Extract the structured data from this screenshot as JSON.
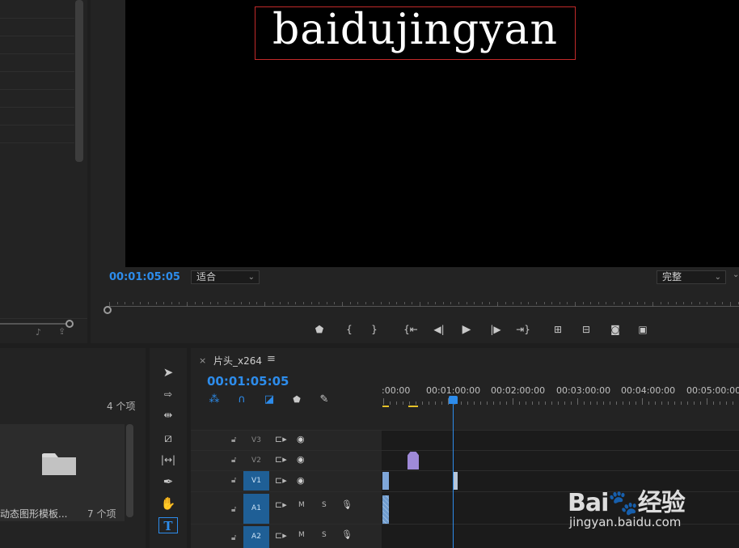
{
  "program_monitor": {
    "title_text": "baidujingyan",
    "timecode": "00:01:05:05",
    "fit_dropdown": "适合",
    "quality_dropdown": "完整"
  },
  "transport_icons": [
    "marker-icon",
    "mark-in-icon",
    "mark-out-icon",
    "go-to-in-icon",
    "step-back-icon",
    "play-icon",
    "step-forward-icon",
    "go-to-out-icon",
    "lift-icon",
    "extract-icon",
    "export-frame-icon",
    "compare-icon"
  ],
  "project_panel": {
    "item_count": "4 个项",
    "bin_name": "动态图形模板...",
    "bin_count": "7 个项"
  },
  "tools": [
    "selection-tool-icon",
    "track-select-tool-icon",
    "ripple-edit-tool-icon",
    "razor-tool-icon",
    "slip-tool-icon",
    "pen-tool-icon",
    "hand-tool-icon",
    "type-tool-icon"
  ],
  "timeline": {
    "sequence_name": "片头_x264",
    "timecode": "00:01:05:05",
    "ruler_labels": [
      ":00:00",
      "00:01:00:00",
      "00:02:00:00",
      "00:03:00:00",
      "00:04:00:00",
      "00:05:00:00"
    ],
    "tracks": [
      {
        "name": "V3",
        "type": "video",
        "selected": false
      },
      {
        "name": "V2",
        "type": "video",
        "selected": false
      },
      {
        "name": "V1",
        "type": "video",
        "selected": true
      },
      {
        "name": "A1",
        "type": "audio",
        "selected": true
      },
      {
        "name": "A2",
        "type": "audio",
        "selected": true
      }
    ],
    "audio_mute": "M",
    "audio_solo": "S"
  },
  "watermark": {
    "logo": "Bai🐾经验",
    "url": "jingyan.baidu.com"
  },
  "colors": {
    "accent": "#2d8ceb",
    "title_box": "#c12a2a",
    "clip_purple": "#9f8ad8",
    "clip_blue": "#7fa7da"
  }
}
